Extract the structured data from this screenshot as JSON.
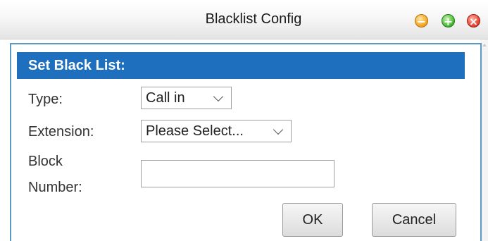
{
  "window": {
    "title": "Blacklist Config",
    "min_icon": "minimize-icon",
    "max_icon": "maximize-icon",
    "close_icon": "close-icon"
  },
  "section": {
    "header": "Set Black List:"
  },
  "form": {
    "type_label": "Type:",
    "type_value": "Call in",
    "extension_label": "Extension:",
    "extension_value": "Please Select...",
    "block_label_line1": "Block",
    "block_label_line2": "Number:",
    "block_value": ""
  },
  "buttons": {
    "ok_label": "OK",
    "cancel_label": "Cancel"
  },
  "colors": {
    "header_bg": "#1f6fbf",
    "panel_border": "#5d9bc7",
    "header_text": "#ffffff"
  }
}
